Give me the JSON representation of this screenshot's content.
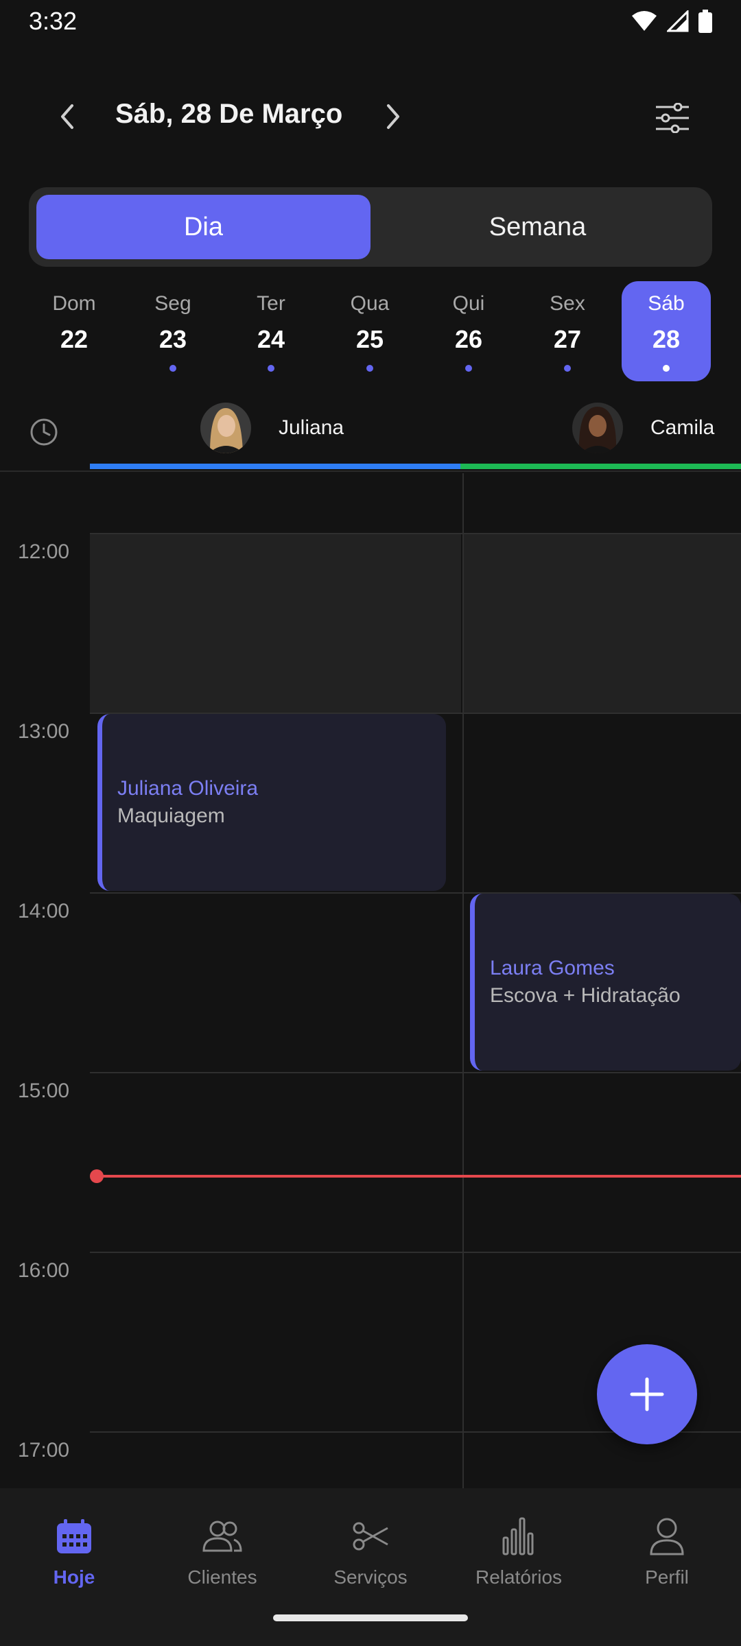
{
  "status_bar": {
    "time": "3:32"
  },
  "header": {
    "title": "Sáb, 28 De Março"
  },
  "view_toggle": {
    "day_label": "Dia",
    "week_label": "Semana",
    "selected": "Dia"
  },
  "days": [
    {
      "name": "Dom",
      "num": "22",
      "has_events": false
    },
    {
      "name": "Seg",
      "num": "23",
      "has_events": true
    },
    {
      "name": "Ter",
      "num": "24",
      "has_events": true
    },
    {
      "name": "Qua",
      "num": "25",
      "has_events": true
    },
    {
      "name": "Qui",
      "num": "26",
      "has_events": true
    },
    {
      "name": "Sex",
      "num": "27",
      "has_events": true
    },
    {
      "name": "Sáb",
      "num": "28",
      "has_events": true,
      "selected": true
    }
  ],
  "staff": [
    {
      "name": "Juliana",
      "color": "#2f7ef5"
    },
    {
      "name": "Camila",
      "color": "#1db954"
    }
  ],
  "times": [
    "12:00",
    "13:00",
    "14:00",
    "15:00",
    "16:00",
    "17:00"
  ],
  "appointments": [
    {
      "client": "Juliana Oliveira",
      "service": "Maquiagem"
    },
    {
      "client": "Laura Gomes",
      "service": "Escova + Hidratação"
    }
  ],
  "colors": {
    "accent": "#6366f1",
    "now_line": "#e5484d",
    "background": "#131313"
  },
  "bottom_nav": {
    "hoje": "Hoje",
    "clientes": "Clientes",
    "servicos": "Serviços",
    "relatorios": "Relatórios",
    "perfil": "Perfil",
    "active": "Hoje"
  }
}
